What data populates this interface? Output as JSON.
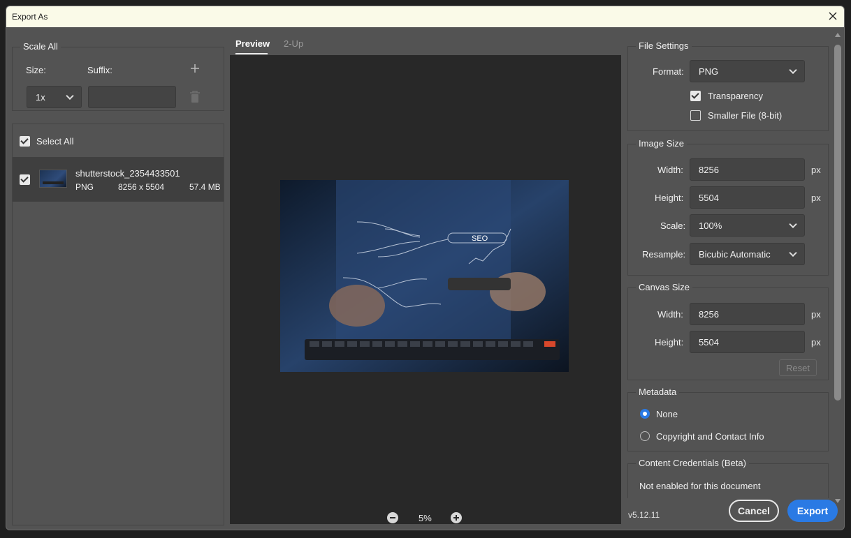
{
  "window": {
    "title": "Export As"
  },
  "scale_all": {
    "legend": "Scale All",
    "size_label": "Size:",
    "suffix_label": "Suffix:",
    "size_value": "1x",
    "suffix_value": ""
  },
  "files": {
    "select_all": "Select All",
    "items": [
      {
        "name": "shutterstock_2354433501",
        "format": "PNG",
        "dimensions": "8256 x 5504",
        "size": "57.4 MB"
      }
    ]
  },
  "preview": {
    "tabs": [
      {
        "label": "Preview"
      },
      {
        "label": "2-Up"
      }
    ],
    "image_text": "SEO",
    "zoom": "5%"
  },
  "file_settings": {
    "legend": "File Settings",
    "format_label": "Format:",
    "format_value": "PNG",
    "transparency": "Transparency",
    "smaller_file": "Smaller File (8-bit)"
  },
  "image_size": {
    "legend": "Image Size",
    "width_label": "Width:",
    "width_value": "8256",
    "height_label": "Height:",
    "height_value": "5504",
    "scale_label": "Scale:",
    "scale_value": "100%",
    "resample_label": "Resample:",
    "resample_value": "Bicubic Automatic",
    "unit": "px"
  },
  "canvas_size": {
    "legend": "Canvas Size",
    "width_label": "Width:",
    "width_value": "8256",
    "height_label": "Height:",
    "height_value": "5504",
    "unit": "px",
    "reset": "Reset"
  },
  "metadata": {
    "legend": "Metadata",
    "none": "None",
    "copyright": "Copyright and Contact Info"
  },
  "content_credentials": {
    "legend": "Content Credentials (Beta)",
    "status": "Not enabled for this document"
  },
  "footer": {
    "version": "v5.12.11",
    "cancel": "Cancel",
    "export": "Export"
  },
  "colors": {
    "accent": "#2a7ae4",
    "panel": "#535353",
    "preview_bg": "#282828"
  }
}
